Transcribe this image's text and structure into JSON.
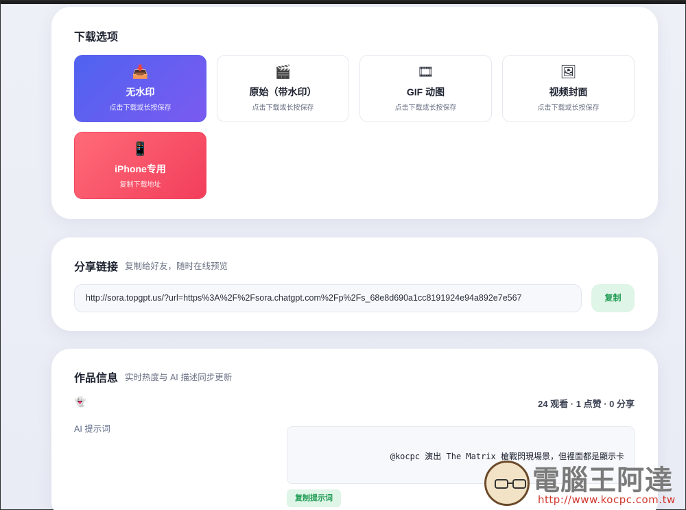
{
  "download": {
    "title": "下载选项",
    "options": [
      {
        "icon": "📥",
        "icon_name": "inbox-tray-icon",
        "label": "无水印",
        "hint": "点击下载或长按保存"
      },
      {
        "icon": "🎬",
        "icon_name": "clapper-board-icon",
        "label": "原始（带水印）",
        "hint": "点击下载或长按保存"
      },
      {
        "icon": "🎞",
        "icon_name": "film-frames-icon",
        "label": "GIF 动图",
        "hint": "点击下载或长按保存"
      },
      {
        "icon": "🖼",
        "icon_name": "framed-picture-icon",
        "label": "视频封面",
        "hint": "点击下载或长按保存"
      },
      {
        "icon": "📱",
        "icon_name": "mobile-phone-icon",
        "label": "iPhone专用",
        "hint": "复制下载地址"
      }
    ]
  },
  "share": {
    "title": "分享链接",
    "subtitle": "复制给好友，随时在线预览",
    "url": "http://sora.topgpt.us/?url=https%3A%2F%2Fsora.chatgpt.com%2Fp%2Fs_68e8d690a1cc8191924e94a892e7e567",
    "copy_label": "复制"
  },
  "info": {
    "title": "作品信息",
    "subtitle": "实时热度与 AI 描述同步更新",
    "ghost_icon": "👻",
    "stats": "24 观看 · 1 点赞 · 0 分享",
    "ai_prompt_label": "AI 提示词",
    "prompt_text": "@kocpc 演出 The Matrix  槍戰閃現場景，但裡面都是顯示卡",
    "copy_prompt_label": "复制提示词"
  },
  "watermark": {
    "text": "電腦王阿達",
    "url": "http://www.kocpc.com.tw"
  },
  "colors": {
    "accent_purple": "#5b63ee",
    "accent_red": "#f2475f",
    "success_green": "#1f9b53"
  }
}
